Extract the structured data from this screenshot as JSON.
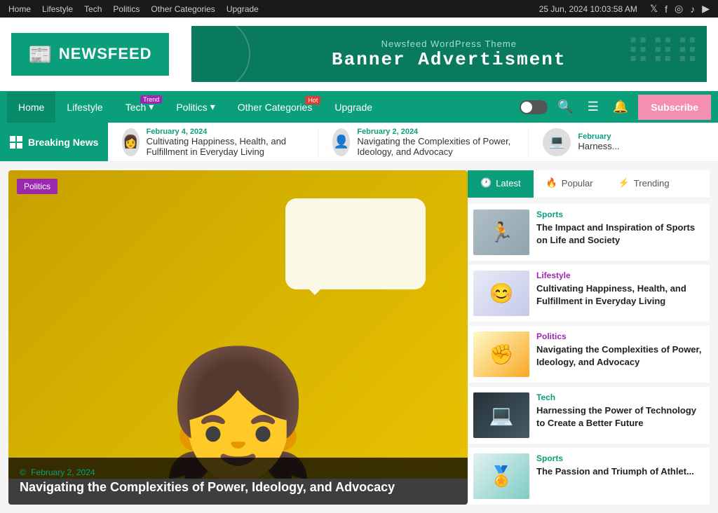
{
  "topbar": {
    "nav_items": [
      "Home",
      "Lifestyle",
      "Tech",
      "Politics",
      "Other Categories",
      "Upgrade"
    ],
    "datetime": "25 Jun, 2024 10:03:58 AM",
    "social_icons": [
      "𝕏",
      "f",
      "◎",
      "♪",
      "▶"
    ]
  },
  "header": {
    "logo_icon": "📰",
    "logo_text": "NEWSFEED",
    "banner_sub": "Newsfeed WordPress Theme",
    "banner_main": "Banner Advertisment"
  },
  "navbar": {
    "items": [
      {
        "label": "Home",
        "active": true,
        "badge": null
      },
      {
        "label": "Lifestyle",
        "active": false,
        "badge": null
      },
      {
        "label": "Tech",
        "active": false,
        "badge": "Trend",
        "badge_type": "trend"
      },
      {
        "label": "Politics",
        "active": false,
        "badge": null
      },
      {
        "label": "Other Categories",
        "active": false,
        "badge": "Hot",
        "badge_type": "hot"
      },
      {
        "label": "Upgrade",
        "active": false,
        "badge": null
      }
    ],
    "subscribe_label": "Subscribe"
  },
  "breaking_news": {
    "label": "Breaking News",
    "items": [
      {
        "date": "February 4, 2024",
        "title": "Cultivating Happiness, Health, and Fulfillment in Everyday Living",
        "avatar": "👩"
      },
      {
        "date": "February 2, 2024",
        "title": "Navigating the Complexities of Power, Ideology, and Advocacy",
        "avatar": "👤"
      },
      {
        "date": "February",
        "title": "Harness...",
        "avatar": "💻"
      }
    ]
  },
  "featured": {
    "tag": "Politics",
    "date": "February 2, 2024",
    "title": "Navigating the Complexities of Power, Ideology, and Advocacy",
    "date_icon": "©"
  },
  "sidebar": {
    "tabs": [
      {
        "label": "Latest",
        "icon": "🕐",
        "active": true
      },
      {
        "label": "Popular",
        "icon": "🔥",
        "active": false
      },
      {
        "label": "Trending",
        "icon": "⚡",
        "active": false
      }
    ],
    "articles": [
      {
        "category": "Sports",
        "category_class": "sports",
        "title": "The Impact and Inspiration of Sports on Life and Society",
        "thumb_class": "thumb-sports1",
        "thumb_icon": "🏃"
      },
      {
        "category": "Lifestyle",
        "category_class": "lifestyle",
        "title": "Cultivating Happiness, Health, and Fulfillment in Everyday Living",
        "thumb_class": "thumb-lifestyle",
        "thumb_icon": "😊"
      },
      {
        "category": "Politics",
        "category_class": "politics",
        "title": "Navigating the Complexities of Power, Ideology, and Advocacy",
        "thumb_class": "thumb-politics",
        "thumb_icon": "✊"
      },
      {
        "category": "Tech",
        "category_class": "tech",
        "title": "Harnessing the Power of Technology to Create a Better Future",
        "thumb_class": "thumb-tech",
        "thumb_icon": "💻"
      },
      {
        "category": "Sports",
        "category_class": "sports",
        "title": "The Passion and Triumph of Athlet...",
        "thumb_class": "thumb-sports2",
        "thumb_icon": "🏅"
      }
    ]
  }
}
